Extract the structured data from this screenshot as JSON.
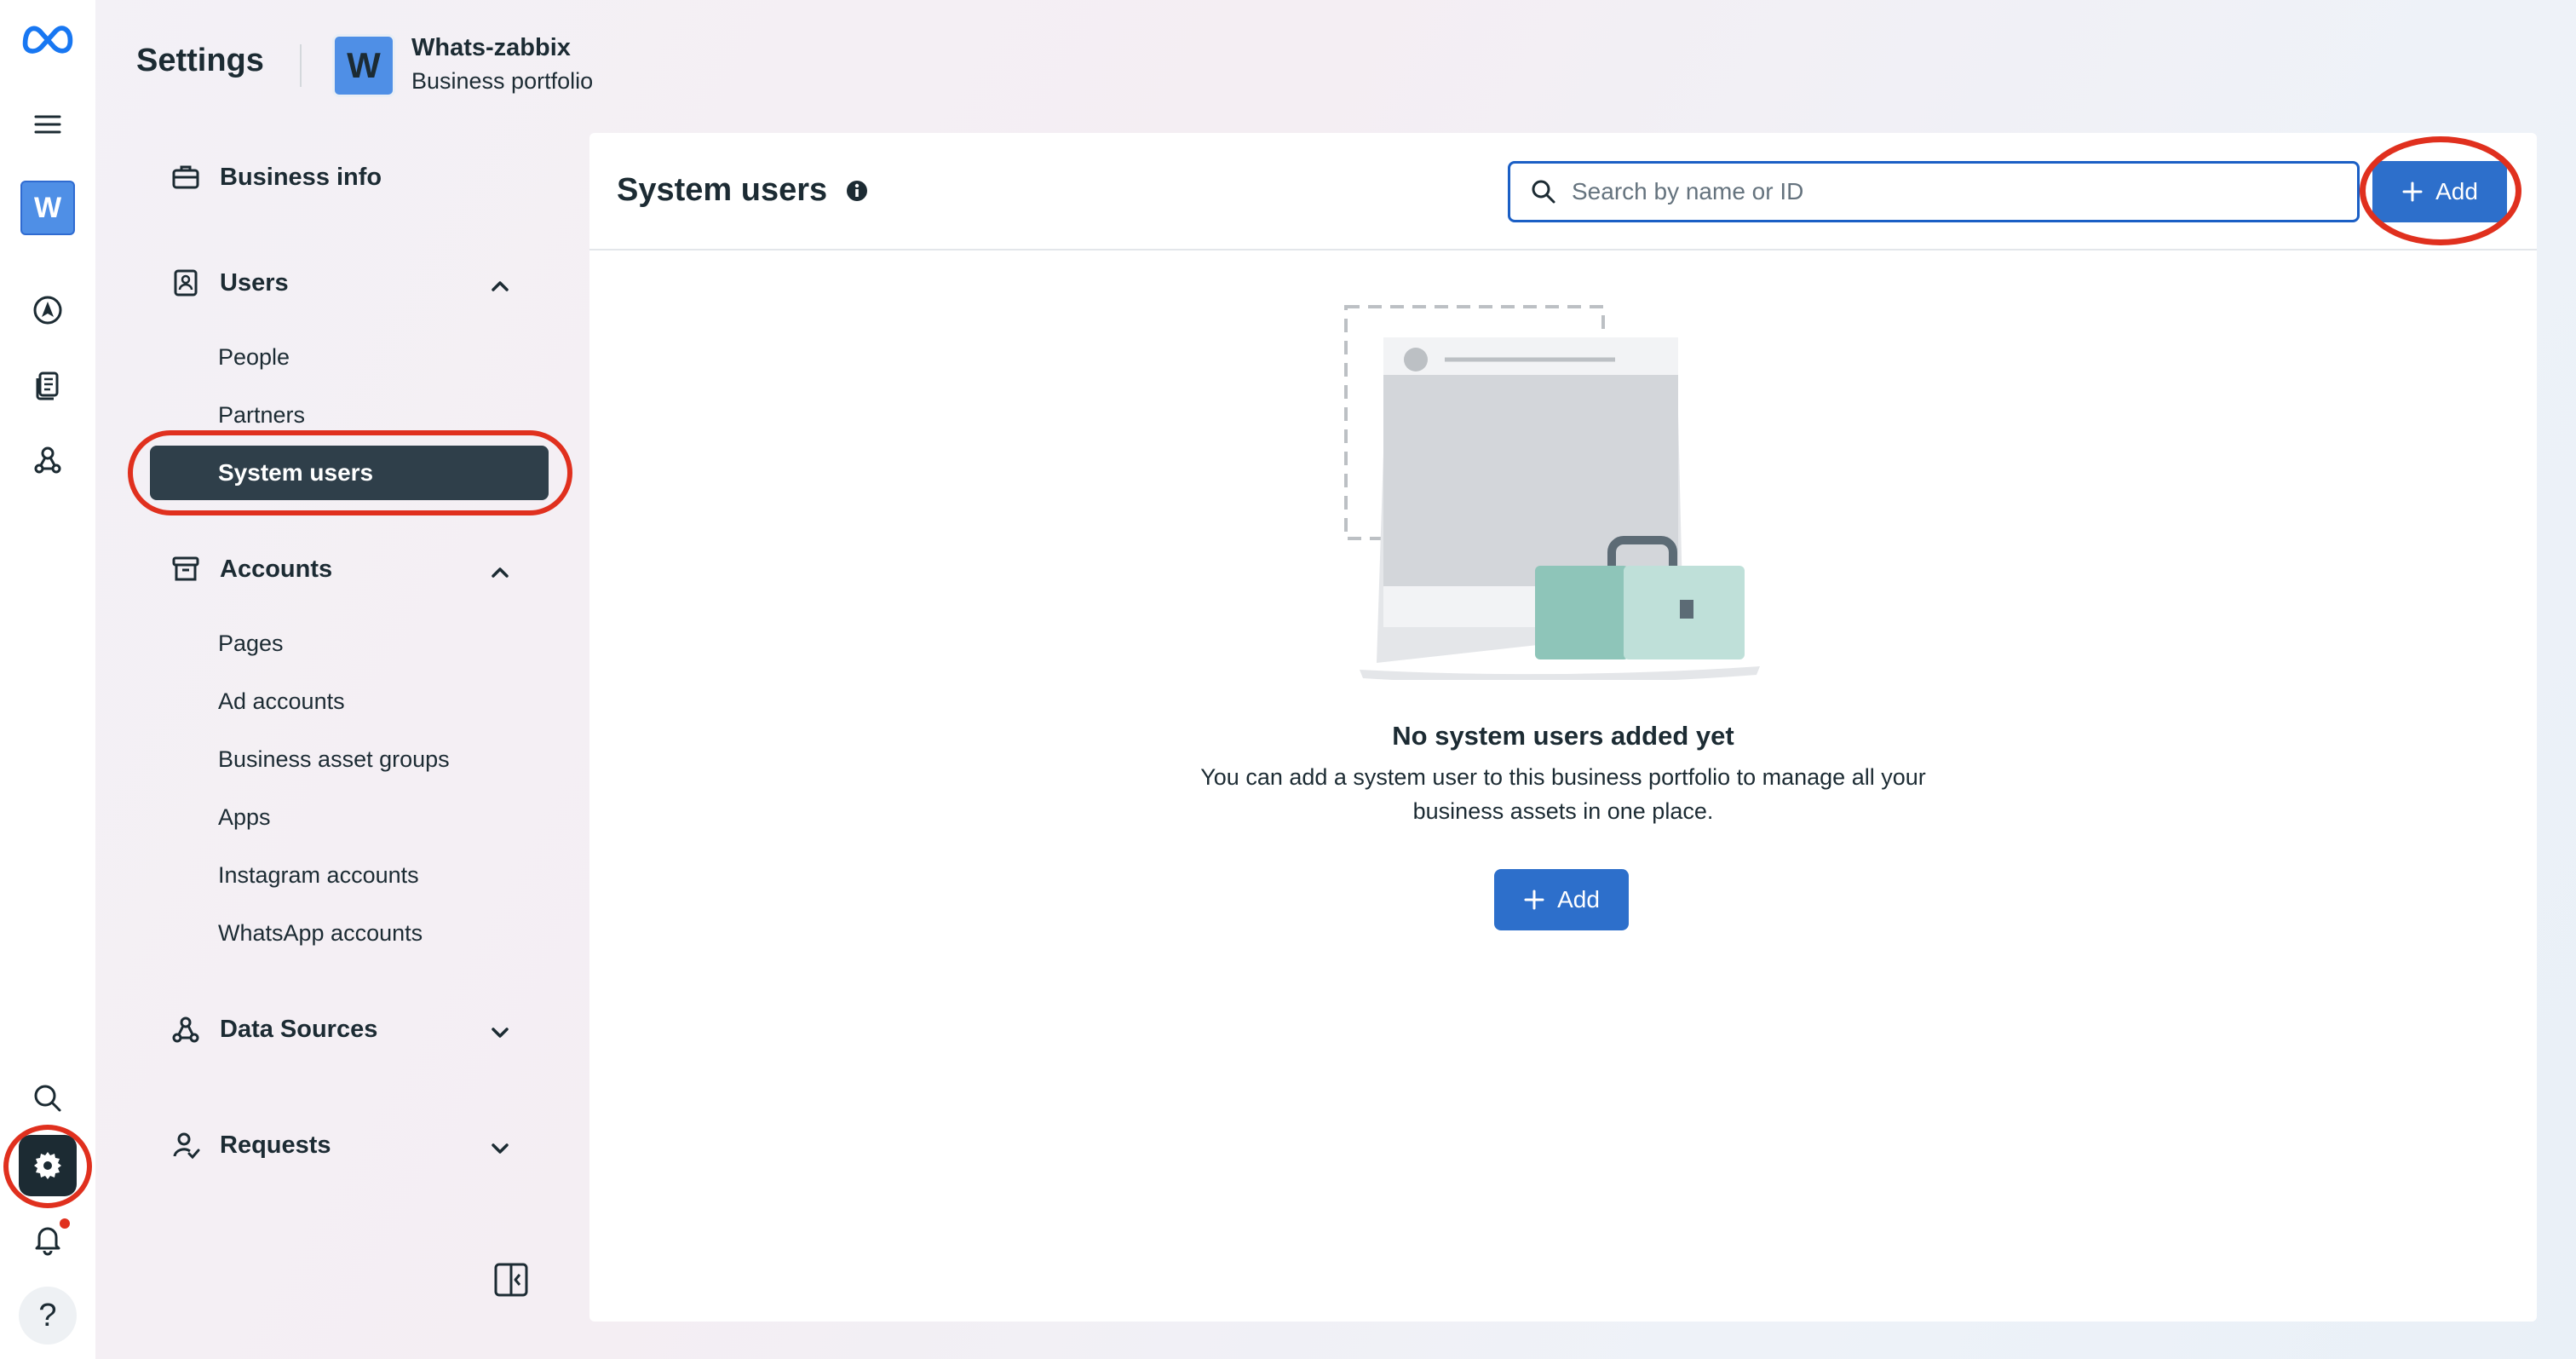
{
  "rail": {
    "workspace_initial": "W",
    "help_glyph": "?",
    "has_notification_dot": true,
    "accent": "#e0301e"
  },
  "header": {
    "title": "Settings",
    "portfolio": {
      "initial": "W",
      "name": "Whats-zabbix",
      "subtitle": "Business portfolio"
    }
  },
  "sidebar": {
    "sections": [
      {
        "label": "Business info",
        "icon": "briefcase-icon"
      },
      {
        "label": "Users",
        "icon": "user-badge-icon",
        "expanded": true,
        "items": [
          "People",
          "Partners",
          "System users"
        ],
        "active": "System users"
      },
      {
        "label": "Accounts",
        "icon": "archive-icon",
        "expanded": true,
        "items": [
          "Pages",
          "Ad accounts",
          "Business asset groups",
          "Apps",
          "Instagram accounts",
          "WhatsApp accounts"
        ]
      },
      {
        "label": "Data Sources",
        "icon": "data-sources-icon",
        "expanded": false
      },
      {
        "label": "Requests",
        "icon": "requests-icon",
        "expanded": false
      }
    ]
  },
  "main": {
    "title": "System users",
    "search": {
      "placeholder": "Search by name or ID",
      "value": ""
    },
    "add_label": "Add",
    "empty": {
      "title": "No system users added yet",
      "description": "You can add a system user to this business portfolio to manage all your business assets in one place.",
      "add_label": "Add"
    },
    "primary_color": "#2d6fcb"
  }
}
